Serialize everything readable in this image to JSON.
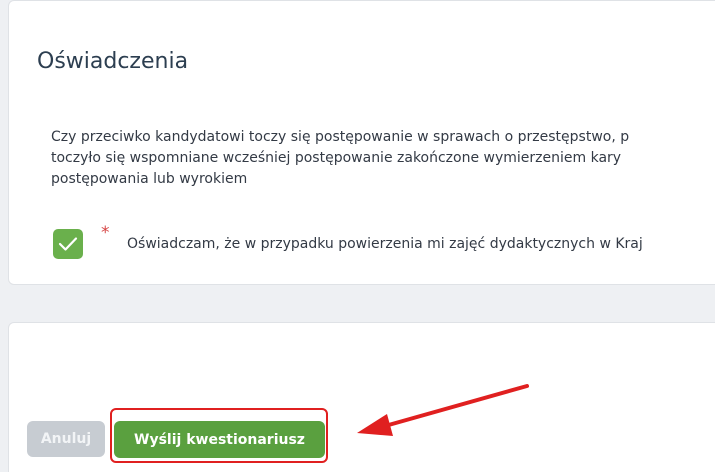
{
  "declarations": {
    "title": "Oświadczenia",
    "question_lines": [
      "Czy przeciwko kandydatowi toczy się postępowanie w sprawach o przestępstwo, p",
      "toczyło się wspomniane wcześniej postępowanie zakończone wymierzeniem kary",
      "postępowania lub wyrokiem"
    ],
    "consent": {
      "checked": true,
      "required_mark": "*",
      "text": "Oświadczam, że w przypadku powierzenia mi zajęć dydaktycznych w Kraj"
    }
  },
  "actions": {
    "cancel_label": "Anuluj",
    "submit_label": "Wyślij kwestionariusz"
  },
  "colors": {
    "submit": "#5aa03f",
    "checkbox": "#6ab04c",
    "annotation": "#e02020",
    "cancel": "#c7ccd2"
  },
  "icons": {
    "checkbox": "check-icon",
    "annotation": "red-arrow-icon"
  }
}
